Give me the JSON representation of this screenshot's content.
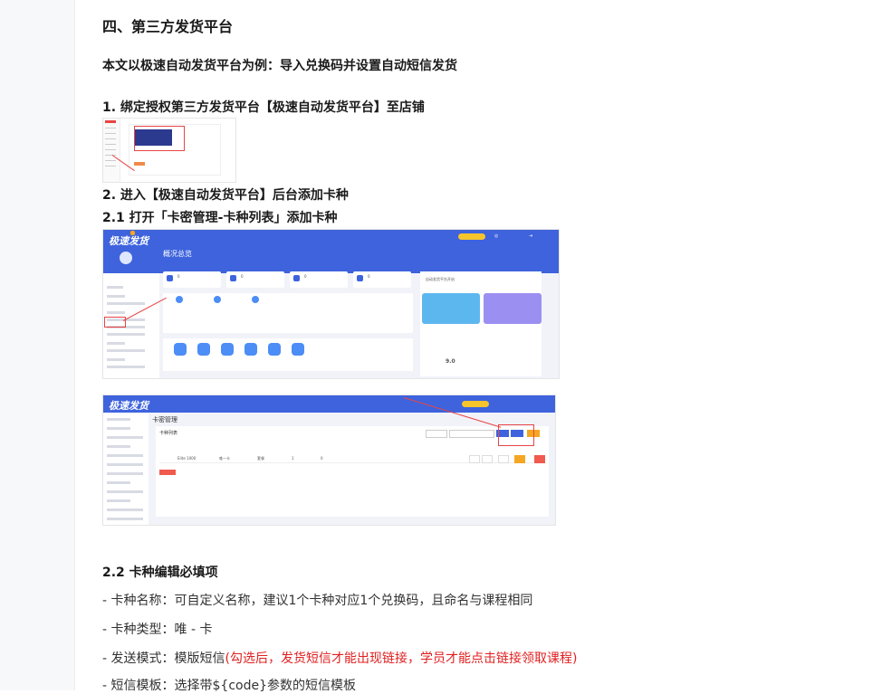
{
  "doc": {
    "section_title": "四、第三方发货平台",
    "intro": "本文以极速自动发货平台为例：导入兑换码并设置自动短信发货",
    "step1": "1. 绑定授权第三方发货平台【极速自动发货平台】至店铺",
    "step2": "2. 进入【极速自动发货平台】后台添加卡种",
    "step2_1": "2.1 打开「卡密管理-卡种列表」添加卡种",
    "step2_2": "2.2 卡种编辑必填项",
    "item_name": "- 卡种名称：可自定义名称，建议1个卡种对应1个兑换码，且命名与课程相同",
    "item_type": "- 卡种类型：唯 - 卡",
    "item_mode_prefix": "- 发送模式：模版短信",
    "item_mode_note": "(勾选后，发货短信才能出现链接，学员才能点击链接领取课程)",
    "item_template": "- 短信模板：选择带${code}参数的短信模板"
  },
  "shot2": {
    "logo": "极速发货",
    "title": "概况总览",
    "stats": [
      "0",
      "0",
      "0",
      "0"
    ],
    "right_title": "自动发货平台开启",
    "right_value": "9.0"
  },
  "shot3": {
    "logo": "极速发货",
    "page_title": "卡密管理",
    "tab": "卡种列表",
    "row": [
      "Elite 1000",
      "唯一卡",
      "套餐",
      "1",
      "0"
    ],
    "del": "批量删除"
  },
  "colors": {
    "accent": "#3e63dd",
    "annotation": "#e94545",
    "note": "#e02020"
  }
}
